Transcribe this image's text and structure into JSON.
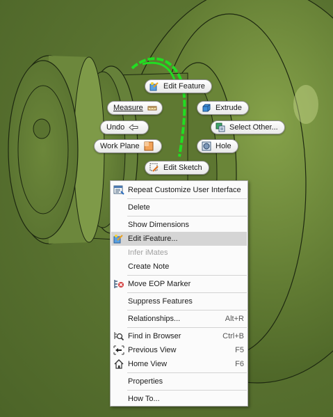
{
  "marking_menu": {
    "edit_feature": "Edit Feature",
    "measure": "Measure",
    "extrude": "Extrude",
    "undo": "Undo",
    "select_other": "Select Other...",
    "work_plane": "Work Plane",
    "hole": "Hole",
    "edit_sketch": "Edit Sketch"
  },
  "context_menu": {
    "items": [
      {
        "label": "Repeat Customize User Interface",
        "shortcut": "",
        "icon": "customize-ui-icon"
      },
      {
        "label": "Delete",
        "shortcut": ""
      },
      {
        "label": "Show Dimensions",
        "shortcut": ""
      },
      {
        "label": "Edit iFeature...",
        "shortcut": "",
        "icon": "edit-ifeature-icon",
        "highlighted": true
      },
      {
        "label": "Infer iMates",
        "shortcut": "",
        "disabled": true
      },
      {
        "label": "Create Note",
        "shortcut": ""
      },
      {
        "label": "Move EOP Marker",
        "shortcut": "",
        "icon": "move-eop-marker-icon"
      },
      {
        "label": "Suppress Features",
        "shortcut": ""
      },
      {
        "label": "Relationships...",
        "shortcut": "Alt+R"
      },
      {
        "label": "Find in Browser",
        "shortcut": "Ctrl+B",
        "icon": "find-in-browser-icon"
      },
      {
        "label": "Previous View",
        "shortcut": "F5",
        "icon": "previous-view-icon"
      },
      {
        "label": "Home View",
        "shortcut": "F6",
        "icon": "home-view-icon"
      },
      {
        "label": "Properties",
        "shortcut": ""
      },
      {
        "label": "How To...",
        "shortcut": ""
      }
    ]
  },
  "colors": {
    "viewport_background": "#5b7431",
    "selection_highlight": "#22dd22",
    "menu_background": "#fbfbfb",
    "menu_highlight": "#d5d5d5"
  }
}
